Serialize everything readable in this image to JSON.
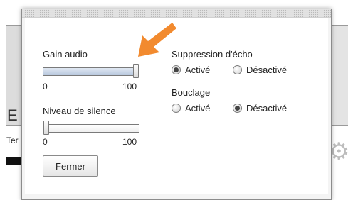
{
  "background": {
    "big_text": "E",
    "small_text": "Ter"
  },
  "dialog": {
    "gain_label": "Gain audio",
    "gain_slider": {
      "min": "0",
      "max": "100",
      "value": 100
    },
    "silence_label": "Niveau de silence",
    "silence_slider": {
      "min": "0",
      "max": "100",
      "value": 0
    },
    "echo_label": "Suppression d'écho",
    "echo_options": {
      "on": "Activé",
      "off": "Désactivé",
      "selected": "on"
    },
    "loop_label": "Bouclage",
    "loop_options": {
      "on": "Activé",
      "off": "Désactivé",
      "selected": "off"
    },
    "close_button": "Fermer"
  },
  "annotation": {
    "arrow_color": "#f28a2e"
  },
  "icons": {
    "gear": "gear-icon"
  }
}
